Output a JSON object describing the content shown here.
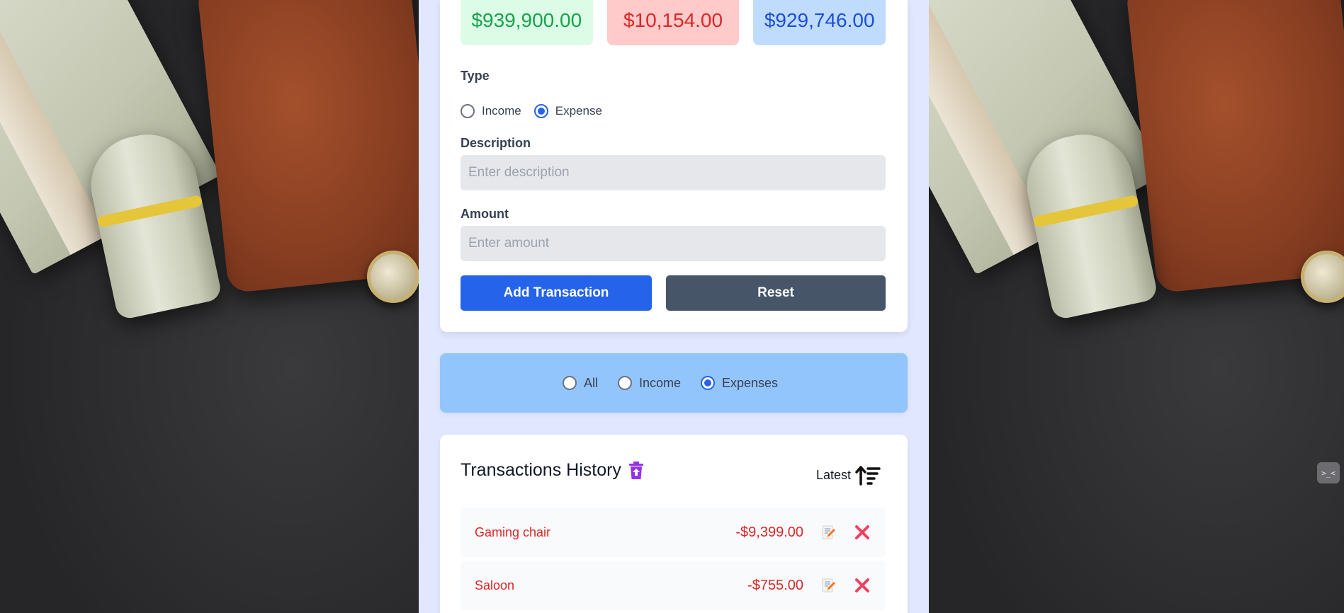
{
  "summary": {
    "income": {
      "amount": "$939,900.00",
      "color": "#16a34a"
    },
    "expense": {
      "amount": "$10,154.00",
      "color": "#dc2626"
    },
    "balance": {
      "amount": "$929,746.00",
      "color": "#1d4ed8"
    }
  },
  "form": {
    "type_label": "Type",
    "type_options": [
      {
        "label": "Income",
        "checked": false
      },
      {
        "label": "Expense",
        "checked": true
      }
    ],
    "description_label": "Description",
    "description_placeholder": "Enter description",
    "description_value": "",
    "amount_label": "Amount",
    "amount_placeholder": "Enter amount",
    "amount_value": "",
    "add_button": "Add Transaction",
    "reset_button": "Reset"
  },
  "filter": {
    "options": [
      {
        "label": "All",
        "checked": false
      },
      {
        "label": "Income",
        "checked": false
      },
      {
        "label": "Expenses",
        "checked": true
      }
    ]
  },
  "history": {
    "title": "Transactions History",
    "title_icon": "trash-restore-icon",
    "sort_label": "Latest",
    "sort_icon": "sort-descending-icon",
    "transactions": [
      {
        "description": "Gaming chair",
        "amount": "-$9,399.00",
        "type": "expense"
      },
      {
        "description": "Saloon",
        "amount": "-$755.00",
        "type": "expense"
      }
    ]
  },
  "side_widget": {
    "icon": "terminal-icon"
  }
}
